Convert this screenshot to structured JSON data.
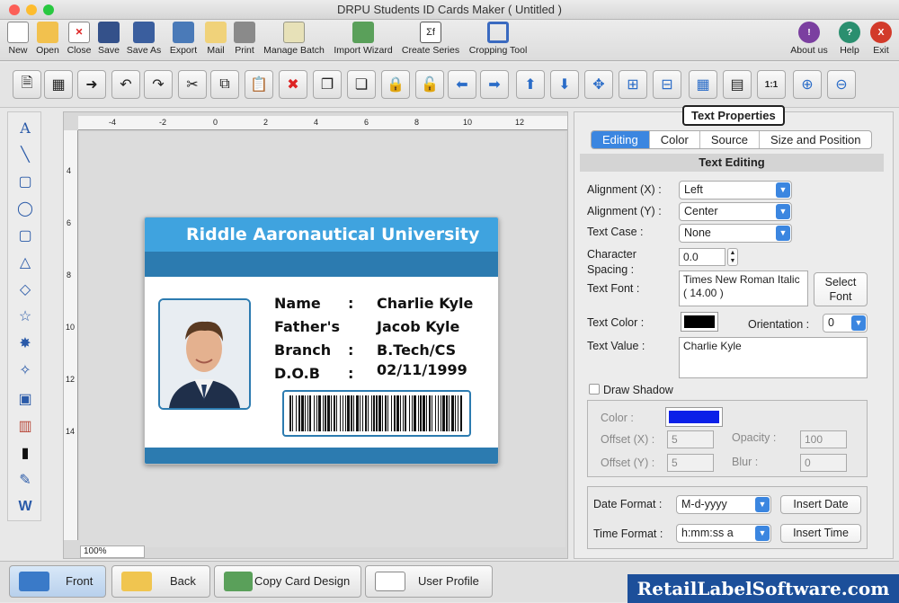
{
  "window": {
    "title": "DRPU Students ID Cards Maker ( Untitled )"
  },
  "toolbar": [
    {
      "label": "New",
      "icon": "new-icon"
    },
    {
      "label": "Open",
      "icon": "open-icon"
    },
    {
      "label": "Close",
      "icon": "close-icon"
    },
    {
      "label": "Save",
      "icon": "save-icon"
    },
    {
      "label": "Save As",
      "icon": "save-as-icon"
    },
    {
      "label": "Export",
      "icon": "export-icon"
    },
    {
      "label": "Mail",
      "icon": "mail-icon"
    },
    {
      "label": "Print",
      "icon": "print-icon"
    },
    {
      "label": "Manage Batch",
      "icon": "manage-batch-icon"
    },
    {
      "label": "Import Wizard",
      "icon": "import-wizard-icon"
    },
    {
      "label": "Create Series",
      "icon": "create-series-icon"
    },
    {
      "label": "Cropping Tool",
      "icon": "cropping-tool-icon"
    }
  ],
  "toolbar_right": [
    {
      "label": "About us",
      "glyph": "!",
      "color": "#7b3fa0"
    },
    {
      "label": "Help",
      "glyph": "?",
      "color": "#2a8f6f"
    },
    {
      "label": "Exit",
      "glyph": "X",
      "color": "#d23a2a"
    }
  ],
  "zoom": "100%",
  "card": {
    "university": "Riddle Aaronautical University",
    "fields": [
      {
        "label": "Name",
        "value": "Charlie Kyle"
      },
      {
        "label": "Father's",
        "value": "Jacob Kyle"
      },
      {
        "label": "Branch",
        "value": "B.Tech/CS"
      },
      {
        "label": "D.O.B",
        "value": "02/11/1999"
      }
    ],
    "sep": ":"
  },
  "ruler_labels": [
    "-4",
    "-2",
    "0",
    "2",
    "4",
    "6",
    "8",
    "10",
    "12"
  ],
  "ruler_v_labels": [
    "4",
    "6",
    "8",
    "10",
    "12",
    "14"
  ],
  "panel": {
    "title": "Text Properties",
    "tabs": [
      "Editing",
      "Color",
      "Source",
      "Size and Position"
    ],
    "section": "Text Editing",
    "align_x_label": "Alignment (X) :",
    "align_x": "Left",
    "align_y_label": "Alignment (Y) :",
    "align_y": "Center",
    "text_case_label": "Text Case :",
    "text_case": "None",
    "char_spacing_label1": "Character",
    "char_spacing_label2": "Spacing :",
    "char_spacing": "0.0",
    "text_font_label": "Text Font :",
    "text_font": "Times New Roman Italic ( 14.00 )",
    "select_font": "Select Font",
    "text_color_label": "Text Color :",
    "text_color": "#000000",
    "orientation_label": "Orientation :",
    "orientation": "0",
    "text_value_label": "Text Value :",
    "text_value": "Charlie Kyle",
    "draw_shadow": "Draw Shadow",
    "shadow_color_label": "Color :",
    "shadow_color": "#0b1fe8",
    "offset_x_label": "Offset (X) :",
    "offset_x": "5",
    "offset_y_label": "Offset (Y) :",
    "offset_y": "5",
    "opacity_label": "Opacity :",
    "opacity": "100",
    "blur_label": "Blur :",
    "blur": "0",
    "date_format_label": "Date Format :",
    "date_format": "M-d-yyyy",
    "insert_date": "Insert Date",
    "time_format_label": "Time Format :",
    "time_format": "h:mm:ss a",
    "insert_time": "Insert Time"
  },
  "bottom": {
    "front": "Front",
    "back": "Back",
    "copy": "Copy Card Design",
    "profile": "User Profile",
    "brand": "RetailLabelSoftware.com"
  }
}
